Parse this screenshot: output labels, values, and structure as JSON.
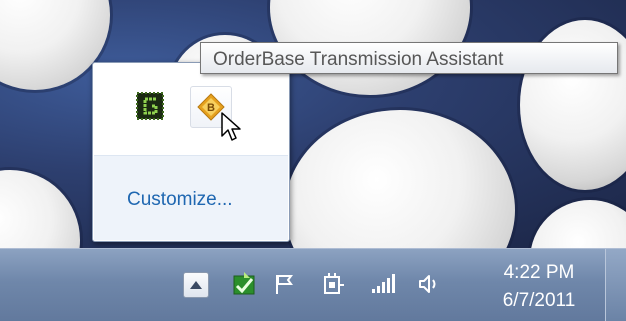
{
  "tooltip": {
    "text": "OrderBase Transmission Assistant"
  },
  "overflow": {
    "icons": [
      "green-app-icon",
      "orderbase-icon"
    ],
    "customize_label": "Customize..."
  },
  "taskbar": {
    "tray_icons": [
      "show-hidden-icons-arrow-icon",
      "green-check-app-icon",
      "action-center-flag-icon",
      "power-plug-icon",
      "network-signal-icon",
      "volume-speaker-icon"
    ]
  },
  "clock": {
    "time": "4:22 PM",
    "date": "6/7/2011"
  },
  "colors": {
    "link": "#1f67b1",
    "taskbar": "#6f87aa",
    "tooltip_text": "#575757"
  }
}
